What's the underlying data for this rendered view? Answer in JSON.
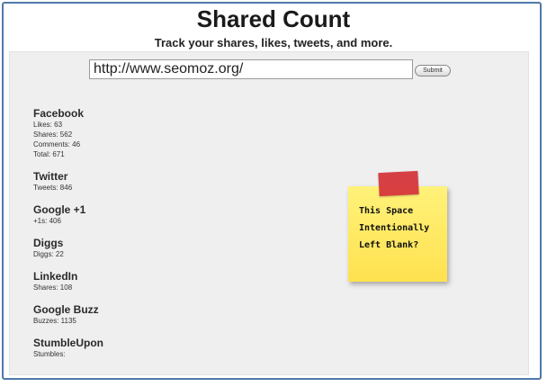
{
  "header": {
    "title": "Shared Count",
    "tagline": "Track your shares, likes, tweets, and more."
  },
  "search": {
    "url_value": "http://www.seomoz.org/",
    "submit_label": "Submit"
  },
  "networks": [
    {
      "name": "Facebook",
      "lines": [
        "Likes: 63",
        "Shares: 562",
        "Comments: 46",
        "Total: 671"
      ]
    },
    {
      "name": "Twitter",
      "lines": [
        "Tweets: 846"
      ]
    },
    {
      "name": "Google +1",
      "lines": [
        "+1s: 406"
      ]
    },
    {
      "name": "Diggs",
      "lines": [
        "Diggs: 22"
      ]
    },
    {
      "name": "LinkedIn",
      "lines": [
        "Shares: 108"
      ]
    },
    {
      "name": "Google Buzz",
      "lines": [
        "Buzzes: 1135"
      ]
    },
    {
      "name": "StumbleUpon",
      "lines": [
        "Stumbles:"
      ]
    }
  ],
  "note": {
    "lines": [
      "This Space",
      "Intentionally",
      "Left Blank?"
    ],
    "tape_color": "#d5373c",
    "paper_color": "#ffe14f"
  }
}
